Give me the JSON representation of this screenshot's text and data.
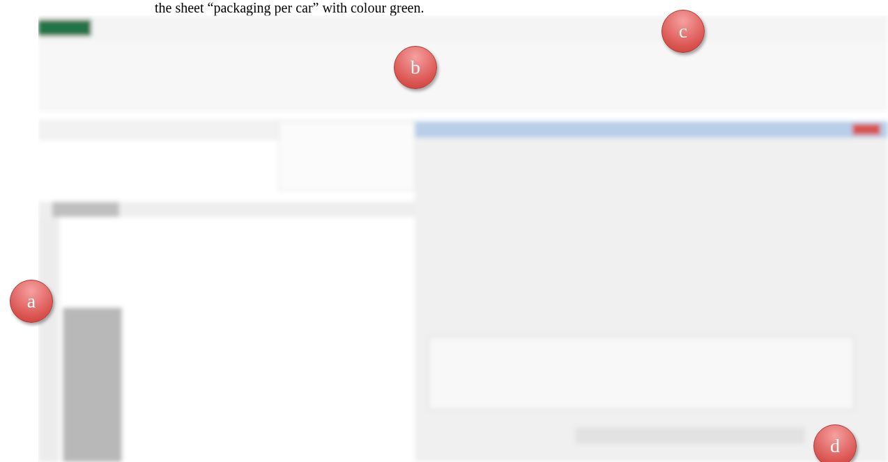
{
  "caption": "the sheet “packaging per car” with colour green.",
  "callouts": [
    {
      "label": "a"
    },
    {
      "label": "b"
    },
    {
      "label": "c"
    },
    {
      "label": "d"
    }
  ]
}
